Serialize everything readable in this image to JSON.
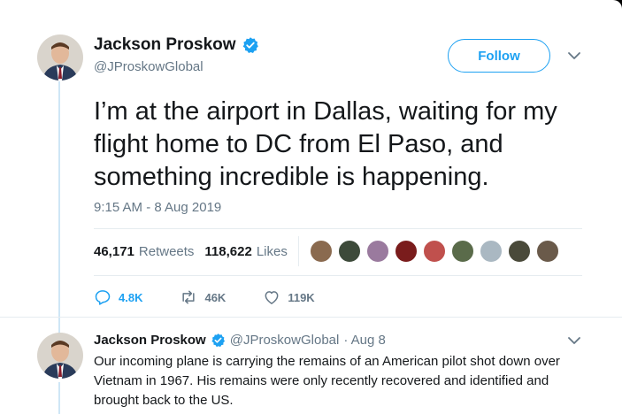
{
  "tweet": {
    "author_name": "Jackson Proskow",
    "author_handle": "@JProskowGlobal",
    "follow_label": "Follow",
    "text": "I’m at the airport in Dallas, waiting for my flight home to DC from El Paso, and something incredible is happening.",
    "timestamp": "9:15 AM - 8 Aug 2019",
    "retweets_count": "46,171",
    "retweets_label": "Retweets",
    "likes_count": "118,622",
    "likes_label": "Likes",
    "likers": [
      {
        "name": "liker-1",
        "color": "#8a6a4f"
      },
      {
        "name": "liker-2",
        "color": "#3d4a3a"
      },
      {
        "name": "liker-3",
        "color": "#9a7a9e"
      },
      {
        "name": "liker-4",
        "color": "#7a1c1c"
      },
      {
        "name": "liker-5",
        "color": "#c0504d"
      },
      {
        "name": "liker-6",
        "color": "#5a6b4a"
      },
      {
        "name": "liker-7",
        "color": "#aab8c2"
      },
      {
        "name": "liker-8",
        "color": "#4a4a3a"
      },
      {
        "name": "liker-9",
        "color": "#6a5a4a"
      }
    ],
    "actions": {
      "reply_count": "4.8K",
      "retweet_count": "46K",
      "like_count": "119K"
    }
  },
  "reply": {
    "author_name": "Jackson Proskow",
    "author_handle": "@JProskowGlobal",
    "date": "· Aug 8",
    "text": "Our incoming plane is carrying the remains of an American pilot shot down over Vietnam in 1967. His remains were only recently recovered and identified and brought back to the US."
  },
  "icons": {
    "verified": "verified-badge-icon",
    "chevron": "chevron-down-icon",
    "reply": "reply-icon",
    "retweet": "retweet-icon",
    "like": "heart-icon"
  },
  "colors": {
    "accent": "#1da1f2",
    "secondary_text": "#657786",
    "primary_text": "#14171a",
    "divider": "#e6ecf0"
  }
}
